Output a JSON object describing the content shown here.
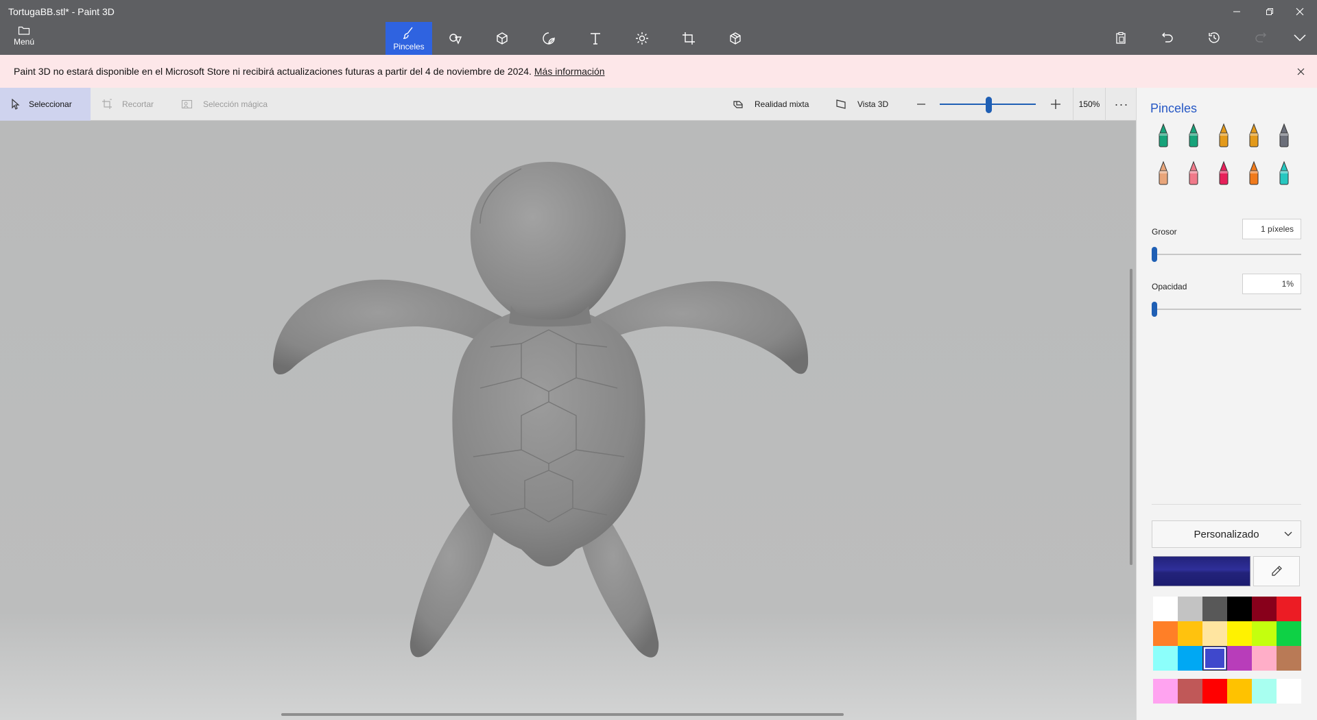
{
  "window": {
    "title": "TortugaBB.stl* - Paint 3D",
    "controls": [
      "minimize",
      "restore",
      "close"
    ]
  },
  "menu": {
    "label": "Menú",
    "icon": "folder-icon"
  },
  "main_tools": [
    {
      "id": "brushes",
      "label": "Pinceles",
      "icon": "brush-icon",
      "active": true
    },
    {
      "id": "2d-shapes",
      "label": "",
      "icon": "2d-shapes-icon",
      "active": false
    },
    {
      "id": "3d-shapes",
      "label": "",
      "icon": "3d-cube-icon",
      "active": false
    },
    {
      "id": "stickers",
      "label": "",
      "icon": "sticker-icon",
      "active": false
    },
    {
      "id": "text",
      "label": "",
      "icon": "text-icon",
      "active": false
    },
    {
      "id": "effects",
      "label": "",
      "icon": "effects-sun-icon",
      "active": false
    },
    {
      "id": "canvas",
      "label": "",
      "icon": "canvas-crop-icon",
      "active": false
    },
    {
      "id": "3d-library",
      "label": "",
      "icon": "3d-library-icon",
      "active": false
    }
  ],
  "right_tools": [
    "paste-icon",
    "undo-icon",
    "history-icon",
    "redo-icon",
    "expand-chevron-icon"
  ],
  "banner": {
    "message": "Paint 3D no estará disponible en el Microsoft Store ni recibirá actualizaciones futuras a partir del 4 de noviembre de 2024.",
    "link": "Más información",
    "background": "#fde7e9"
  },
  "subtoolbar": {
    "select": "Seleccionar",
    "crop": "Recortar",
    "magic_select": "Selección mágica",
    "mixed_reality": "Realidad mixta",
    "view_3d": "Vista 3D",
    "zoom_value": "150%",
    "zoom_level_fraction": 0.5,
    "more": "···"
  },
  "canvas": {
    "model_name": "TortugaBB.stl",
    "model_color": "#8c8c8c",
    "background": "#bcbdbd"
  },
  "panel": {
    "title": "Pinceles",
    "brushes": [
      {
        "name": "marker",
        "icon": "marker-icon",
        "color": "#17a37a"
      },
      {
        "name": "calligraphy-pen",
        "icon": "calligraphy-pen-icon",
        "color": "#17a37a"
      },
      {
        "name": "oil-brush",
        "icon": "oil-brush-icon",
        "color": "#e39a1b"
      },
      {
        "name": "watercolor",
        "icon": "watercolor-icon",
        "color": "#e39a1b"
      },
      {
        "name": "pixel-pen",
        "icon": "pixel-pen-icon",
        "color": "#6c6f7a"
      },
      {
        "name": "pencil",
        "icon": "pencil-icon",
        "color": "#e8a57a"
      },
      {
        "name": "eraser",
        "icon": "eraser-icon",
        "color": "#f07a8a"
      },
      {
        "name": "crayon",
        "icon": "crayon-icon",
        "color": "#e6205a"
      },
      {
        "name": "spray-can",
        "icon": "spray-can-icon",
        "color": "#f07a1b"
      },
      {
        "name": "fill-bucket",
        "icon": "fill-bucket-icon",
        "color": "#27c7c0"
      }
    ],
    "thickness_label": "Grosor",
    "thickness_value": "1 píxeles",
    "thickness_fraction": 0.0,
    "opacity_label": "Opacidad",
    "opacity_value": "1%",
    "opacity_fraction": 0.0,
    "palette_mode": "Personalizado",
    "current_color": "#23237a",
    "palette": [
      "#ffffff",
      "#c3c3c3",
      "#585858",
      "#000000",
      "#88001b",
      "#ec1c24",
      "#ff7f27",
      "#ffc20e",
      "#ffe5a0",
      "#fff200",
      "#c4ff0e",
      "#0ed145",
      "#8cfffb",
      "#00a8f3",
      "#3f48cc",
      "#b83dba",
      "#ffaec8",
      "#b97a56"
    ],
    "selected_swatch": 14,
    "custom_colors": [
      "#ffa3f0",
      "#c05858",
      "#ff0000",
      "#ffc200",
      "#a8fff0",
      "#ffffff"
    ]
  }
}
